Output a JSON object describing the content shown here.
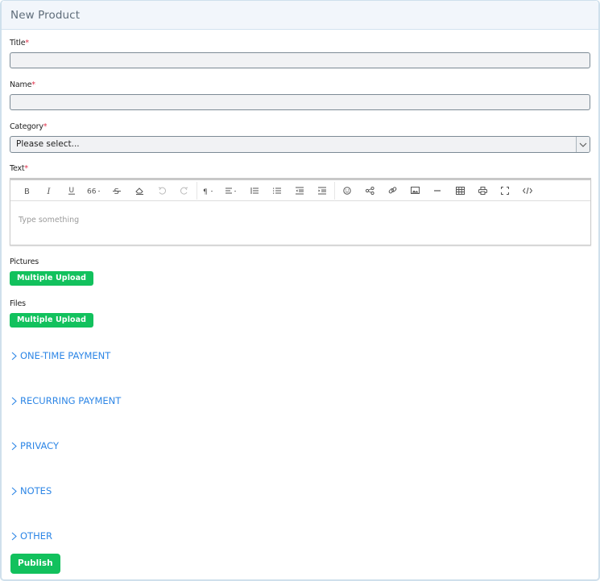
{
  "header": {
    "title": "New Product"
  },
  "form": {
    "title_field": {
      "label": "Title",
      "required_mark": "*",
      "value": ""
    },
    "name_field": {
      "label": "Name",
      "required_mark": "*",
      "value": ""
    },
    "category_field": {
      "label": "Category",
      "required_mark": "*",
      "selected": "Please select..."
    },
    "text_field": {
      "label": "Text",
      "required_mark": "*",
      "placeholder": "Type something",
      "toolbar": [
        {
          "icon": "bold-icon",
          "glyph": "B"
        },
        {
          "icon": "italic-icon",
          "glyph": "I"
        },
        {
          "icon": "underline-icon",
          "glyph": "U"
        },
        {
          "icon": "quote-icon",
          "glyph": "66"
        },
        {
          "icon": "strikethrough-icon",
          "glyph": "S"
        },
        {
          "icon": "eraser-icon",
          "glyph": "⌫"
        },
        {
          "icon": "undo-icon",
          "glyph": "↶"
        },
        {
          "icon": "redo-icon",
          "glyph": "↷"
        },
        {
          "icon": "paragraph-icon",
          "glyph": "¶"
        },
        {
          "icon": "align-icon",
          "glyph": "≡"
        },
        {
          "icon": "ordered-list-icon",
          "glyph": "☰"
        },
        {
          "icon": "unordered-list-icon",
          "glyph": "☰"
        },
        {
          "icon": "indent-decrease-icon",
          "glyph": "⇤"
        },
        {
          "icon": "indent-increase-icon",
          "glyph": "⇥"
        },
        {
          "icon": "emoji-icon",
          "glyph": "☺"
        },
        {
          "icon": "share-icon",
          "glyph": "⋖"
        },
        {
          "icon": "link-icon",
          "glyph": "🔗"
        },
        {
          "icon": "image-icon",
          "glyph": "▣"
        },
        {
          "icon": "horizontal-rule-icon",
          "glyph": "—"
        },
        {
          "icon": "table-icon",
          "glyph": "▦"
        },
        {
          "icon": "print-icon",
          "glyph": "⎙"
        },
        {
          "icon": "fullscreen-icon",
          "glyph": "⛶"
        },
        {
          "icon": "code-icon",
          "glyph": "</>"
        }
      ]
    },
    "pictures": {
      "label": "Pictures",
      "button": "Multiple Upload"
    },
    "files": {
      "label": "Files",
      "button": "Multiple Upload"
    }
  },
  "sections": [
    {
      "label": "ONE-TIME PAYMENT"
    },
    {
      "label": "RECURRING PAYMENT"
    },
    {
      "label": "PRIVACY"
    },
    {
      "label": "NOTES"
    },
    {
      "label": "OTHER"
    }
  ],
  "actions": {
    "publish": "Publish"
  },
  "colors": {
    "accent_blue": "#2d86e6",
    "success_green": "#12c15d",
    "required_red": "#e0304a"
  }
}
